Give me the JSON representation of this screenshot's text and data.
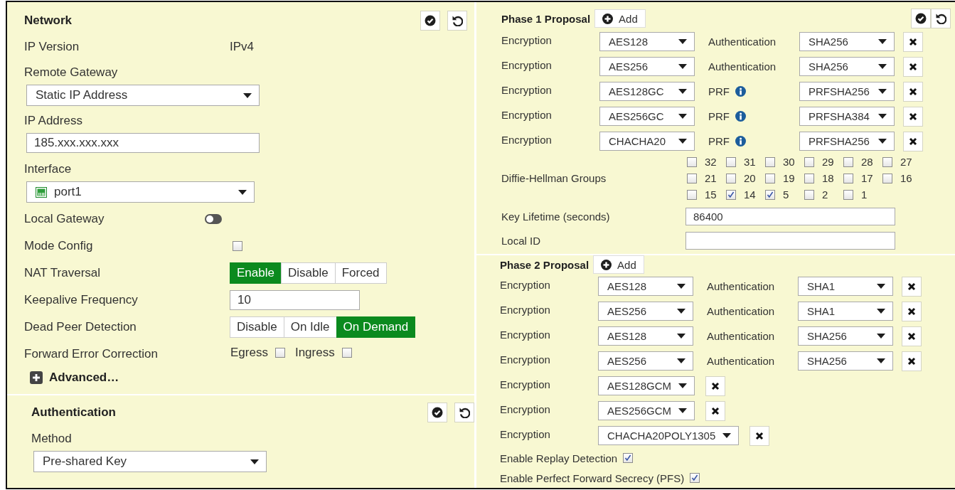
{
  "network": {
    "title": "Network",
    "fields": [
      {
        "kind": "static",
        "label": "IP Version",
        "value": "IPv4"
      },
      {
        "kind": "select",
        "label": "Remote Gateway",
        "value": "Static IP Address"
      },
      {
        "kind": "input",
        "label": "IP Address",
        "value": "185.xxx.xxx.xxx"
      },
      {
        "kind": "interface",
        "label": "Interface",
        "value": "port1"
      },
      {
        "kind": "toggle",
        "label": "Local Gateway",
        "on": false
      },
      {
        "kind": "checkbox",
        "label": "Mode Config",
        "checked": false
      },
      {
        "kind": "segmented",
        "label": "NAT Traversal",
        "options": [
          {
            "label": "Enable",
            "selected": true
          },
          {
            "label": "Disable",
            "selected": false
          },
          {
            "label": "Forced",
            "selected": false
          }
        ]
      },
      {
        "kind": "inline-input",
        "label": "Keepalive Frequency",
        "value": "10"
      },
      {
        "kind": "segmented",
        "label": "Dead Peer Detection",
        "options": [
          {
            "label": "Disable",
            "selected": false
          },
          {
            "label": "On Idle",
            "selected": false
          },
          {
            "label": "On Demand",
            "selected": true
          }
        ]
      },
      {
        "kind": "checks",
        "label": "Forward Error Correction",
        "options": [
          {
            "label": "Egress",
            "checked": false
          },
          {
            "label": "Ingress",
            "checked": false
          }
        ]
      }
    ],
    "advanced": "Advanced…"
  },
  "authentication": {
    "title": "Authentication",
    "method_label": "Method",
    "method": "Pre-shared Key"
  },
  "phase1": {
    "title": "Phase 1 Proposal",
    "add": "Add",
    "proposals": [
      {
        "kind": "auth",
        "encryption_label": "Encryption",
        "encryption": "AES128",
        "second_label": "Authentication",
        "second": "SHA256"
      },
      {
        "kind": "auth",
        "encryption_label": "Encryption",
        "encryption": "AES256",
        "second_label": "Authentication",
        "second": "SHA256"
      },
      {
        "kind": "prf",
        "encryption_label": "Encryption",
        "encryption": "AES128GC",
        "second_label": "PRF",
        "second": "PRFSHA256"
      },
      {
        "kind": "prf",
        "encryption_label": "Encryption",
        "encryption": "AES256GC",
        "second_label": "PRF",
        "second": "PRFSHA384"
      },
      {
        "kind": "prf",
        "encryption_label": "Encryption",
        "encryption": "CHACHA20",
        "second_label": "PRF",
        "second": "PRFSHA256"
      }
    ],
    "dh_label": "Diffie-Hellman Groups",
    "dh_groups": [
      {
        "label": "32",
        "checked": false
      },
      {
        "label": "31",
        "checked": false
      },
      {
        "label": "30",
        "checked": false
      },
      {
        "label": "29",
        "checked": false
      },
      {
        "label": "28",
        "checked": false
      },
      {
        "label": "27",
        "checked": false
      },
      {
        "label": "21",
        "checked": false
      },
      {
        "label": "20",
        "checked": false
      },
      {
        "label": "19",
        "checked": false
      },
      {
        "label": "18",
        "checked": false
      },
      {
        "label": "17",
        "checked": false
      },
      {
        "label": "16",
        "checked": false
      },
      {
        "label": "15",
        "checked": false
      },
      {
        "label": "14",
        "checked": true
      },
      {
        "label": "5",
        "checked": true
      },
      {
        "label": "2",
        "checked": false
      },
      {
        "label": "1",
        "checked": false
      }
    ],
    "key_lifetime_label": "Key Lifetime (seconds)",
    "key_lifetime": "86400",
    "local_id_label": "Local ID"
  },
  "phase2": {
    "title": "Phase 2 Proposal",
    "add": "Add",
    "proposals": [
      {
        "kind": "auth",
        "encryption_label": "Encryption",
        "encryption": "AES128",
        "second_label": "Authentication",
        "second": "SHA1"
      },
      {
        "kind": "auth",
        "encryption_label": "Encryption",
        "encryption": "AES256",
        "second_label": "Authentication",
        "second": "SHA1"
      },
      {
        "kind": "auth",
        "encryption_label": "Encryption",
        "encryption": "AES128",
        "second_label": "Authentication",
        "second": "SHA256"
      },
      {
        "kind": "auth",
        "encryption_label": "Encryption",
        "encryption": "AES256",
        "second_label": "Authentication",
        "second": "SHA256"
      },
      {
        "kind": "single",
        "encryption_label": "Encryption",
        "encryption": "AES128GCM"
      },
      {
        "kind": "single",
        "encryption_label": "Encryption",
        "encryption": "AES256GCM"
      },
      {
        "kind": "single",
        "encryption_label": "Encryption",
        "encryption": "CHACHA20POLY1305"
      }
    ],
    "options": [
      {
        "label": "Enable Replay Detection",
        "checked": true
      },
      {
        "label": "Enable Perfect Forward Secrecy (PFS)",
        "checked": true
      }
    ]
  }
}
